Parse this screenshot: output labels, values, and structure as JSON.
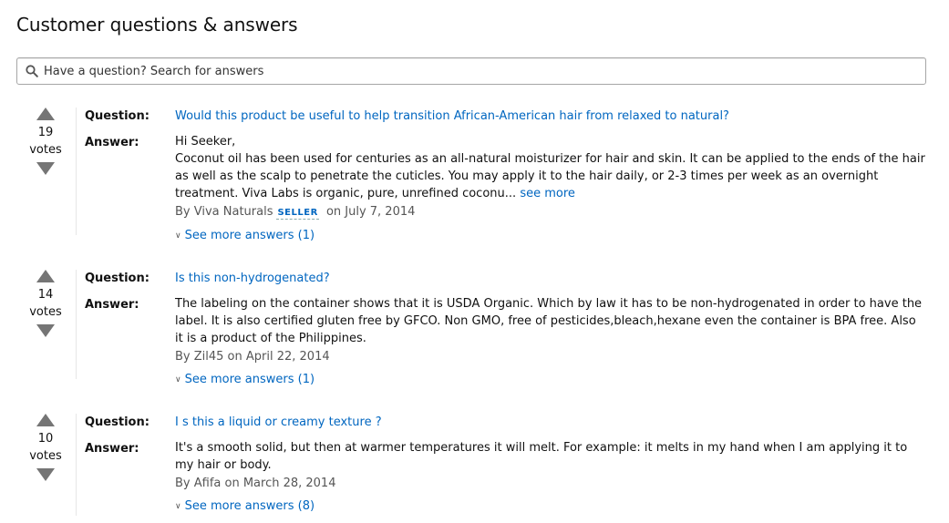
{
  "header": {
    "title": "Customer questions & answers"
  },
  "search": {
    "placeholder": "Have a question? Search for answers",
    "icon": "search-icon"
  },
  "labels": {
    "question": "Question:",
    "answer": "Answer:",
    "votes": "votes"
  },
  "qa": [
    {
      "votes": "19",
      "question": "Would this product be useful to help transition African-American hair from relaxed to natural?",
      "answer_greeting": "Hi Seeker,",
      "answer_body": "Coconut oil has been used for centuries as an all-natural moisturizer for hair and skin. It can be applied to the ends of the hair as well as the scalp to penetrate the cuticles. You may apply it to the hair daily, or 2-3 times per week as an overnight treatment. Viva Labs is organic, pure, unrefined coconu...",
      "see_more": "see more",
      "by": "By Viva Naturals",
      "badge": "SELLER",
      "date": "on July 7, 2014",
      "see_more_answers": "See more answers (1)"
    },
    {
      "votes": "14",
      "question": "Is this non-hydrogenated?",
      "answer_body": "The labeling on the container shows that it is USDA Organic. Which by law it has to be non-hydrogenated in order to have the label. It is also certified gluten free by GFCO. Non GMO, free of pesticides,bleach,hexane even the container is BPA free. Also it is a product of the Philippines.",
      "byline": "By Zil45 on April 22, 2014",
      "see_more_answers": "See more answers (1)"
    },
    {
      "votes": "10",
      "question": "I s this a liquid or creamy texture ?",
      "answer_body": "It's a smooth solid, but then at warmer temperatures it will melt. For example: it melts in my hand when I am applying it to my hair or body.",
      "byline": "By Afifa on March 28, 2014",
      "see_more_answers": "See more answers (8)"
    }
  ],
  "colors": {
    "link": "#0066c0",
    "text": "#111111",
    "muted": "#555555",
    "arrow": "#757575",
    "border": "#a6a6a6"
  }
}
